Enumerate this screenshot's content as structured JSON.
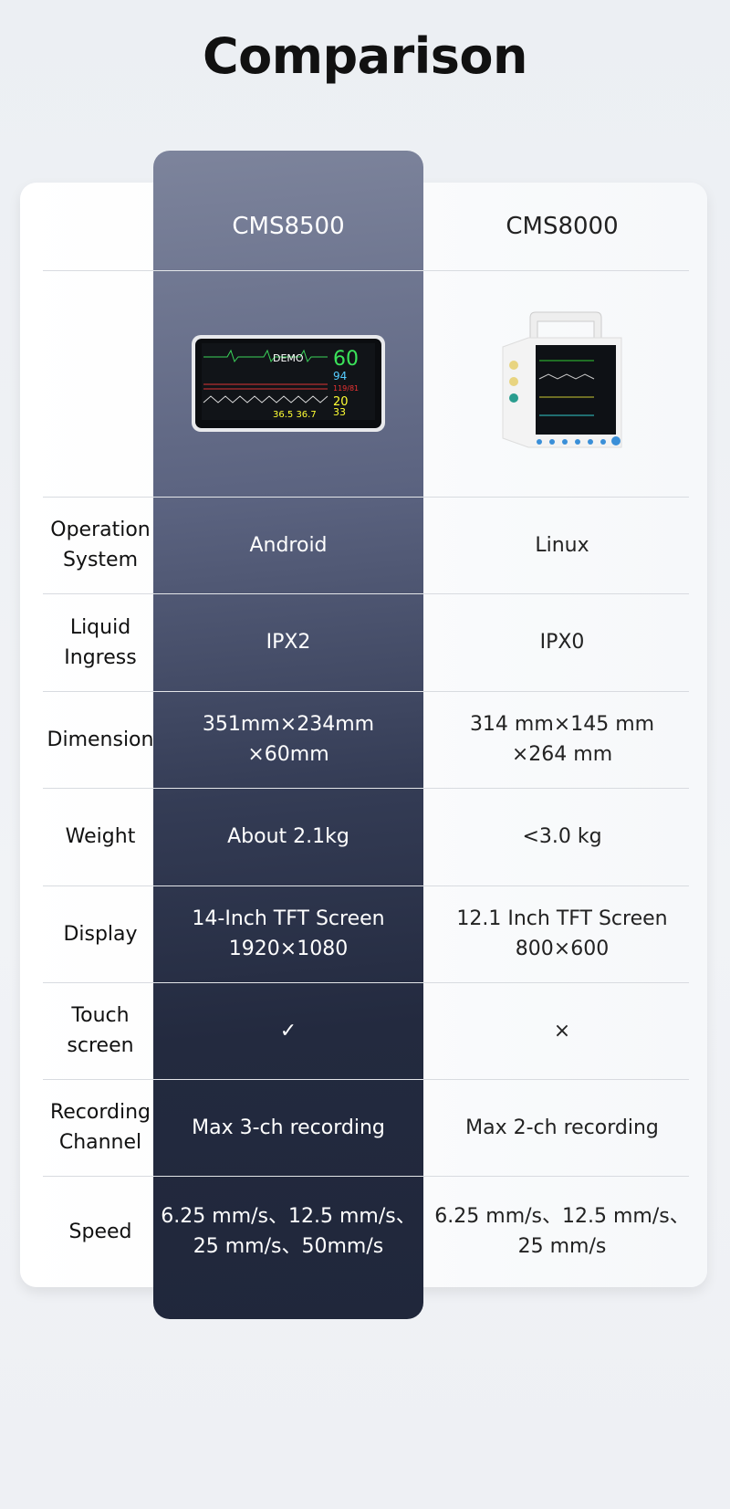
{
  "title": "Comparison",
  "products": [
    {
      "name": "CMS8500",
      "image": "tablet-patient-monitor",
      "screen_text": "DEMO"
    },
    {
      "name": "CMS8000",
      "image": "portable-patient-monitor-with-handle"
    }
  ],
  "rows": [
    {
      "label": "Operation\nSystem",
      "a": "Android",
      "b": "Linux"
    },
    {
      "label": "Liquid\nIngress",
      "a": "IPX2",
      "b": "IPX0"
    },
    {
      "label": "Dimension",
      "a": "351mm×234mm\n×60mm",
      "b": "314 mm×145 mm\n×264 mm"
    },
    {
      "label": "Weight",
      "a": "About 2.1kg",
      "b": "<3.0 kg"
    },
    {
      "label": "Display",
      "a": "14-Inch TFT Screen\n1920×1080",
      "b": "12.1 Inch TFT Screen\n800×600"
    },
    {
      "label": "Touch\nscreen",
      "a": "✓",
      "b": "×"
    },
    {
      "label": "Recording\nChannel",
      "a": "Max 3-ch recording",
      "b": "Max 2-ch recording"
    },
    {
      "label": "Speed",
      "a": "6.25 mm/s、12.5 mm/s、\n25 mm/s、50mm/s",
      "b": "6.25 mm/s、12.5 mm/s、\n25 mm/s"
    }
  ],
  "colors": {
    "highlight_top": "#7d849c",
    "highlight_bottom": "#20273b",
    "background": "#eef0f4"
  }
}
